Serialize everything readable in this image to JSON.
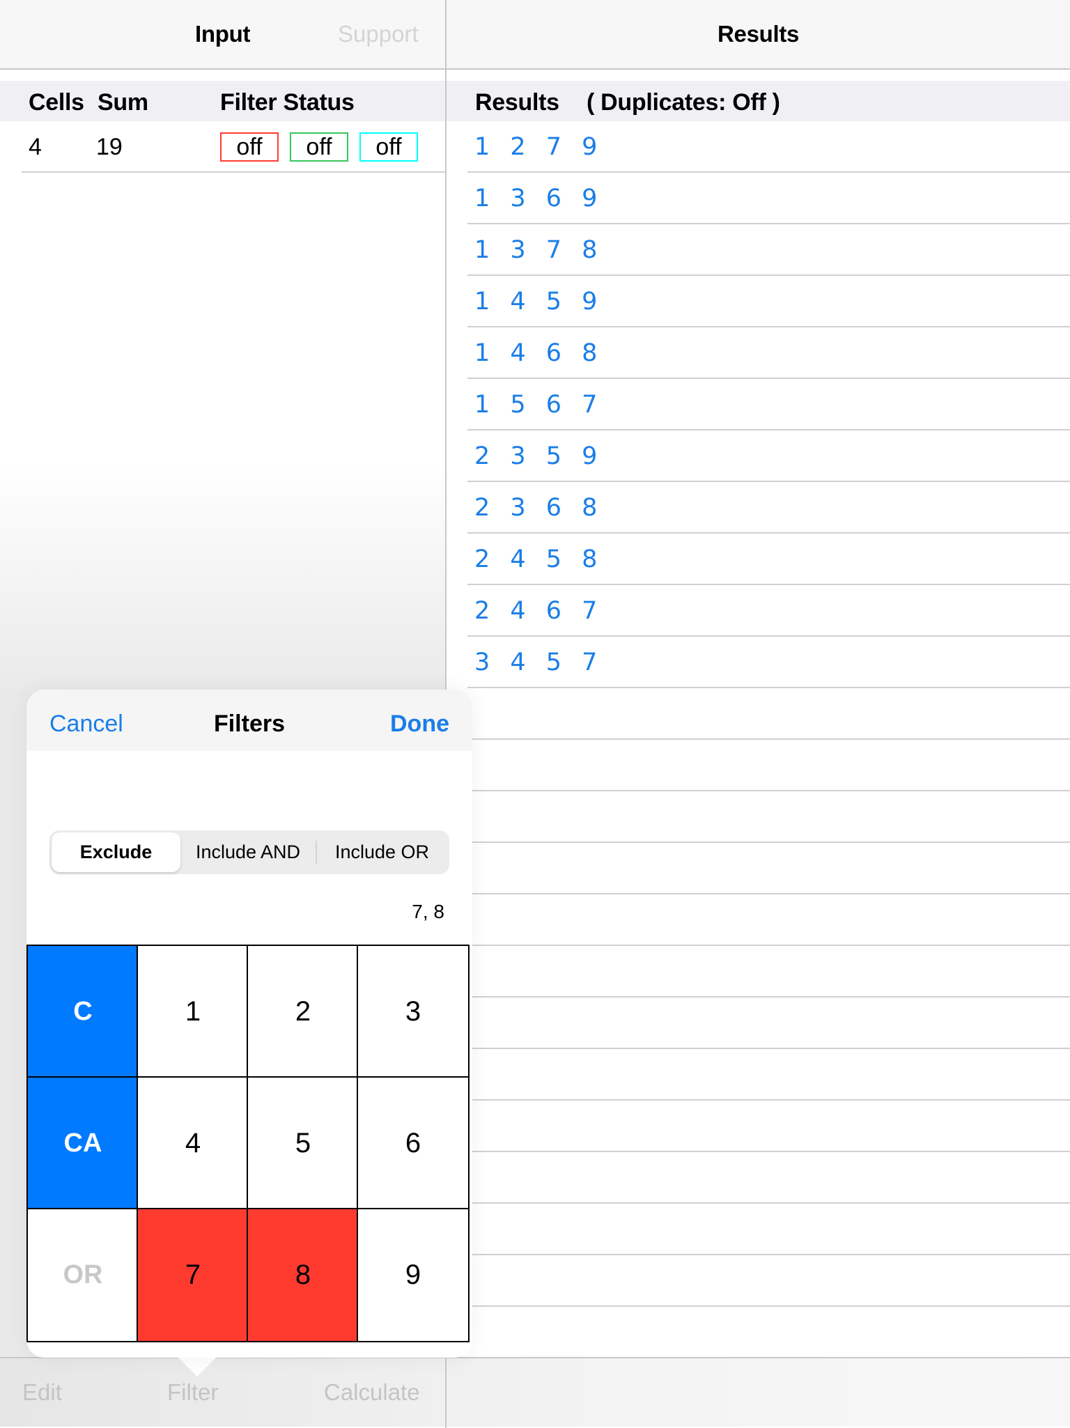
{
  "left_nav": {
    "title": "Input",
    "support_label": "Support"
  },
  "right_nav": {
    "title": "Results"
  },
  "input_table": {
    "headers": {
      "cells": "Cells",
      "sum": "Sum",
      "filter_status": "Filter Status"
    },
    "row": {
      "cells": "4",
      "sum": "19"
    },
    "filter_status": [
      {
        "label": "off",
        "color": "#ff3b30"
      },
      {
        "label": "off",
        "color": "#34c759"
      },
      {
        "label": "off",
        "color": "#00ffff"
      }
    ]
  },
  "results": {
    "header": "Results",
    "duplicates_label": "( Duplicates:  Off )",
    "items": [
      "1 2 7 9",
      "1 3 6 9",
      "1 3 7 8",
      "1 4 5 9",
      "1 4 6 8",
      "1 5 6 7",
      "2 3 5 9",
      "2 3 6 8",
      "2 4 5 8",
      "2 4 6 7",
      "3 4 5 7"
    ]
  },
  "toolbar": {
    "edit": "Edit",
    "filter": "Filter",
    "calculate": "Calculate"
  },
  "popover": {
    "cancel": "Cancel",
    "title": "Filters",
    "done": "Done",
    "segments": [
      "Exclude",
      "Include AND",
      "Include OR"
    ],
    "selected_segment": "Exclude",
    "selection_text": "7, 8",
    "keypad": [
      {
        "label": "C",
        "style": "blue"
      },
      {
        "label": "1",
        "style": "normal"
      },
      {
        "label": "2",
        "style": "normal"
      },
      {
        "label": "3",
        "style": "normal"
      },
      {
        "label": "CA",
        "style": "blue"
      },
      {
        "label": "4",
        "style": "normal"
      },
      {
        "label": "5",
        "style": "normal"
      },
      {
        "label": "6",
        "style": "normal"
      },
      {
        "label": "OR",
        "style": "dim"
      },
      {
        "label": "7",
        "style": "red"
      },
      {
        "label": "8",
        "style": "red"
      },
      {
        "label": "9",
        "style": "normal"
      }
    ]
  },
  "colors": {
    "accent": "#007aff",
    "link": "#1a7ee8",
    "selected_key": "#ff3b30"
  }
}
